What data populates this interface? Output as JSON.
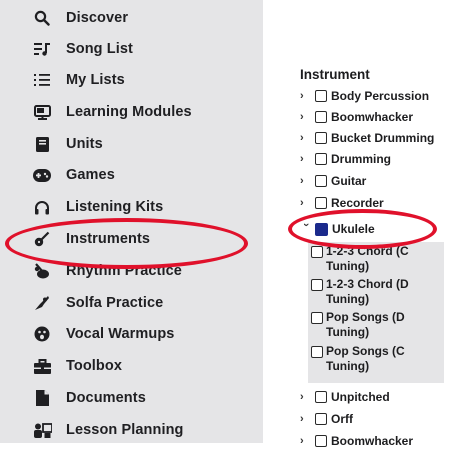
{
  "sidebar": {
    "items": [
      {
        "label": "Discover",
        "icon": "search-icon"
      },
      {
        "label": "Song List",
        "icon": "music-list-icon"
      },
      {
        "label": "My Lists",
        "icon": "numbered-list-icon"
      },
      {
        "label": "Learning Modules",
        "icon": "slideshow-icon"
      },
      {
        "label": "Units",
        "icon": "book-icon"
      },
      {
        "label": "Games",
        "icon": "gamepad-icon"
      },
      {
        "label": "Listening Kits",
        "icon": "headphones-icon"
      },
      {
        "label": "Instruments",
        "icon": "guitar-icon"
      },
      {
        "label": "Rhythm Practice",
        "icon": "drum-icon"
      },
      {
        "label": "Solfa Practice",
        "icon": "hand-sign-icon"
      },
      {
        "label": "Vocal Warmups",
        "icon": "vocal-icon"
      },
      {
        "label": "Toolbox",
        "icon": "toolbox-icon"
      },
      {
        "label": "Documents",
        "icon": "document-icon"
      },
      {
        "label": "Lesson Planning",
        "icon": "lesson-planning-icon"
      }
    ]
  },
  "filter": {
    "title": "Instrument",
    "categories": [
      {
        "label": "Body Percussion"
      },
      {
        "label": "Boomwhacker"
      },
      {
        "label": "Bucket Drumming"
      },
      {
        "label": "Drumming"
      },
      {
        "label": "Guitar"
      },
      {
        "label": "Recorder"
      },
      {
        "label": "Ukulele"
      }
    ],
    "ukulele_children": [
      {
        "label": "1-2-3 Chord (C Tuning)"
      },
      {
        "label": "1-2-3 Chord (D Tuning)"
      },
      {
        "label": "Pop Songs (D Tuning)"
      },
      {
        "label": "Pop Songs (C Tuning)"
      }
    ],
    "after_categories": [
      {
        "label": "Unpitched"
      },
      {
        "label": "Orff"
      },
      {
        "label": "Boomwhacker"
      }
    ]
  },
  "colors": {
    "highlight": "#e0112b",
    "sidebar_bg": "#e5e5e7",
    "checked": "#1b2a8c"
  }
}
